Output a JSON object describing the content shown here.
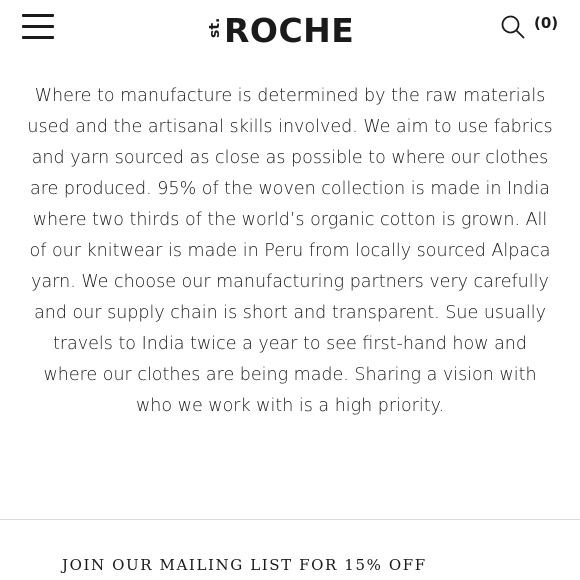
{
  "header": {
    "menu_icon": "hamburger-menu-icon",
    "logo_prefix": "st.",
    "logo_main": "ROCHE",
    "search_icon": "search-icon",
    "cart_count": "(0)"
  },
  "content": {
    "paragraph": "Where to manufacture is determined by the raw materials used and the artisanal skills involved. We aim to use fabrics and yarn sourced as close as possible to where our clothes are produced. 95% of the woven collection is made in India where two thirds of the world’s organic cotton is grown. All of our knitwear is made in Peru from locally sourced Alpaca yarn. We choose our manufacturing partners very carefully and our supply chain is short and transparent. Sue usually travels to India twice a year to see first-hand how and where our clothes are being made. Sharing a vision with who we work with is a high priority."
  },
  "footer": {
    "mailing_label": "JOIN OUR MAILING LIST FOR 15% OFF"
  }
}
